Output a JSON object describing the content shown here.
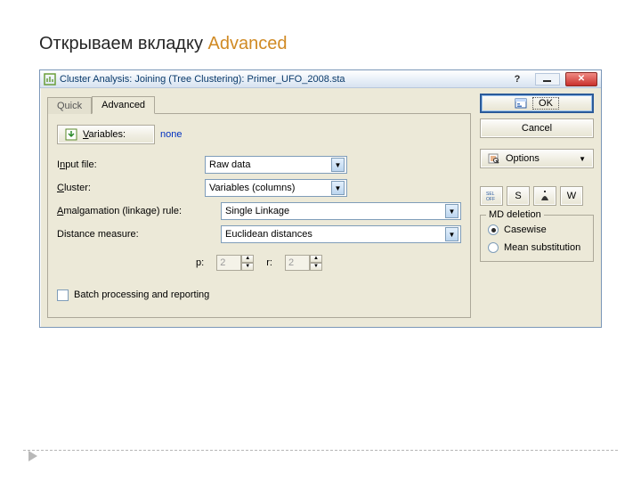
{
  "slide_title_prefix": "Открываем вкладку ",
  "slide_title_hl": "Advanced",
  "window": {
    "title": "Cluster Analysis: Joining (Tree Clustering): Primer_UFO_2008.sta",
    "help": "?",
    "close": "✕"
  },
  "tabs": {
    "quick": "Quick",
    "advanced": "Advanced"
  },
  "buttons": {
    "ok": "OK",
    "cancel": "Cancel",
    "options": "Options",
    "s": "S",
    "w": "W",
    "variables_btn": "Variables:"
  },
  "variables_value": "none",
  "rows": {
    "input_file": {
      "label_pre": "I",
      "label_u": "n",
      "label_post": "put file:",
      "value": "Raw data"
    },
    "cluster": {
      "label_u": "C",
      "label_post": "luster:",
      "value": "Variables (columns)"
    },
    "linkage": {
      "label_u": "A",
      "label_post": "malgamation (linkage) rule:",
      "value": "Single Linkage"
    },
    "distance": {
      "label": "Distance measure:",
      "value": "Euclidean distances"
    }
  },
  "spinners": {
    "p_label": "p:",
    "p_value": "2",
    "r_label": "r:",
    "r_value": "2"
  },
  "batch": {
    "label_u": "B",
    "label_post": "atch processing and reporting"
  },
  "md": {
    "legend_u": "M",
    "legend_post": "D deletion",
    "casewise": "Casewise",
    "mean": "Mean substitution"
  }
}
